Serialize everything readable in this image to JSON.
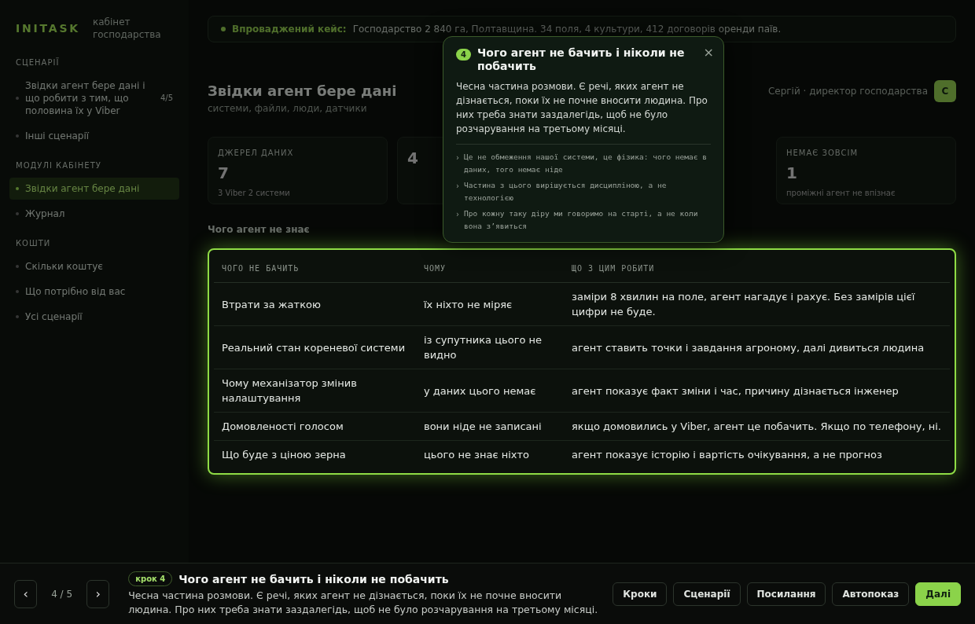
{
  "sidebar": {
    "logo": "INITASK",
    "subtitle": "кабінет господарства",
    "sections": [
      {
        "title": "СЦЕНАРІЇ",
        "items": [
          {
            "label": "Звідки агент бере дані і що робити з тим, що половина їх у Viber",
            "badge": "4/5",
            "selected": false
          },
          {
            "label": "Інші сценарії",
            "selected": false
          }
        ]
      },
      {
        "title": "МОДУЛІ КАБІНЕТУ",
        "items": [
          {
            "label": "Звідки агент бере дані",
            "selected": true
          },
          {
            "label": "Журнал",
            "selected": false
          }
        ]
      },
      {
        "title": "КОШТИ",
        "items": [
          {
            "label": "Скільки коштує",
            "selected": false
          },
          {
            "label": "Що потрібно від вас",
            "selected": false
          },
          {
            "label": "Усі сценарії",
            "selected": false
          }
        ]
      }
    ]
  },
  "banner": {
    "label": "Впроваджений кейс:",
    "text": "Господарство 2 840 га, Полтавщина. 34 поля, 4 культури, 412 договорів оренди паїв."
  },
  "header": {
    "title": "Звідки агент бере дані",
    "subtitle": "системи, файли, люди, датчики",
    "user": "Сергій · директор господарства",
    "avatar": "С"
  },
  "stats": [
    {
      "label": "ДЖЕРЕЛ ДАНИХ",
      "value": "7",
      "note": "3 Viber 2 системи"
    },
    {
      "value": "4"
    },
    {
      "label": "НЕМАЄ ЗОВСІМ",
      "value": "1",
      "note": "проміжні агент не впізнає"
    }
  ],
  "section": {
    "title": "Чого агент не знає"
  },
  "table": {
    "columns": [
      "ЧОГО НЕ БАЧИТЬ",
      "ЧОМУ",
      "ЩО З ЦИМ РОБИТИ"
    ],
    "rows": [
      [
        "Втрати за жаткою",
        "їх ніхто не міряє",
        "заміри 8 хвилин на поле, агент нагадує і рахує. Без замірів цієї цифри не буде."
      ],
      [
        "Реальний стан кореневої системи",
        "із супутника цього не видно",
        "агент ставить точки і завдання агроному, далі дивиться людина"
      ],
      [
        "Чому механізатор змінив налаштування",
        "у даних цього немає",
        "агент показує факт зміни і час, причину дізнається інженер"
      ],
      [
        "Домовленості голосом",
        "вони ніде не записані",
        "якщо домовились у Viber, агент це побачить. Якщо по телефону, ні."
      ],
      [
        "Що буде з ціною зерна",
        "цього не знає ніхто",
        "агент показує історію і вартість очікування, а не прогноз"
      ]
    ]
  },
  "popover": {
    "step": "4",
    "title": "Чого агент не бачить і ніколи не побачить",
    "close": "×",
    "text": "Чесна частина розмови. Є речі, яких агент не дізнається, поки їх не почне вносити людина. Про них треба знати заздалегідь, щоб не було розчарування на третьому місяці.",
    "points": [
      {
        "marker": "›",
        "text": "Це не обмеження нашої системи, це фізика: чого немає в даних, того немає ніде"
      },
      {
        "marker": "›",
        "text": "Частина з цього вирішується дисципліною, а не технологією"
      },
      {
        "marker": "›",
        "text": "Про кожну таку діру ми говоримо на старті, а не коли вона з’явиться"
      }
    ]
  },
  "tour_bar": {
    "prev": "‹",
    "counter": "4 / 5",
    "next": "›",
    "step_badge": "крок 4",
    "title": "Чого агент не бачить і ніколи не побачить",
    "text": "Чесна частина розмови. Є речі, яких агент не дізнається, поки їх не почне вносити людина. Про них треба знати заздалегідь, щоб не було розчарування на третьому місяці.",
    "buttons": [
      {
        "label": "Кроки",
        "primary": false
      },
      {
        "label": "Сценарії",
        "primary": false
      },
      {
        "label": "Посилання",
        "primary": false
      },
      {
        "label": "Автопоказ",
        "primary": false
      },
      {
        "label": "Далі",
        "primary": true
      }
    ]
  }
}
